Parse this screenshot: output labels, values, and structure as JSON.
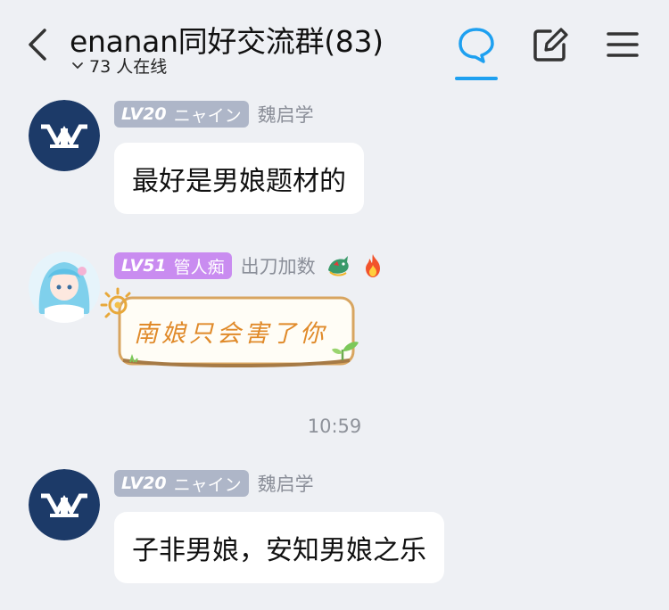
{
  "header": {
    "title": "enanan同好交流群(83)",
    "online_count": "73 人在线",
    "active_tab_color": "#1ea0f0"
  },
  "messages": [
    {
      "level": "LV20",
      "title": "ニャイン",
      "sender": "魏启学",
      "text": "最好是男娘题材的",
      "badge_color": "#aeb6c8"
    },
    {
      "level": "LV51",
      "title": "管人痴",
      "sender": "出刀加数",
      "sticker_text": "南娘只会害了你",
      "badge_color": "#c98cf0"
    },
    {
      "level": "LV20",
      "title": "ニャイン",
      "sender": "魏启学",
      "text": "子非男娘，安知男娘之乐",
      "badge_color": "#aeb6c8"
    }
  ],
  "timestamp": "10:59",
  "icons": [
    "back-icon",
    "chevron-down-icon",
    "chat-bubble-icon",
    "edit-icon",
    "menu-icon",
    "dragon-icon",
    "fire-icon",
    "sun-icon",
    "sprout-icon"
  ]
}
